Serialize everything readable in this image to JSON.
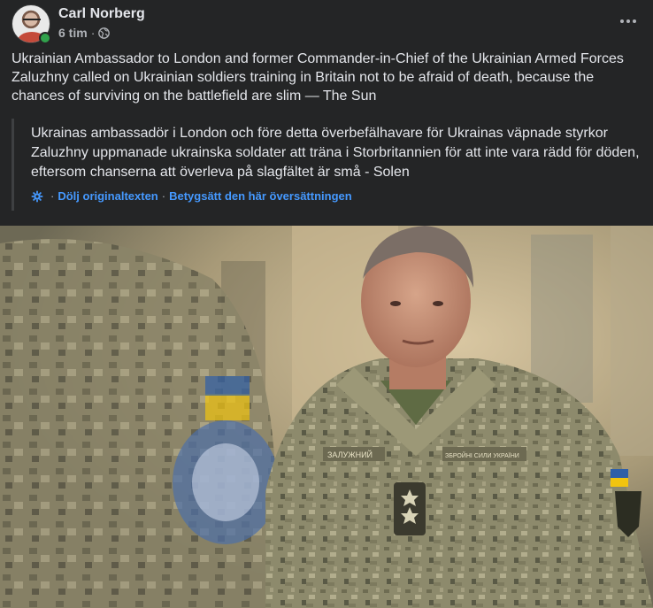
{
  "post": {
    "author": "Carl Norberg",
    "time": "6 tim",
    "separator": "·",
    "audience_icon": "globe-icon",
    "more_icon": "more-options-icon",
    "text": "Ukrainian Ambassador to London and former Commander-in-Chief of the Ukrainian Armed Forces Zaluzhny called on Ukrainian soldiers training in Britain not to be afraid of death, because the chances of surviving on the battlefield are slim — The Sun"
  },
  "translation": {
    "text": "Ukrainas ambassadör i London och före detta överbefälhavare för Ukrainas väpnade styrkor Zaluzhny uppmanade ukrainska soldater att träna i Storbritannien för att inte vara rädd för döden, eftersom chanserna att överleva på slagfältet är små - Solen",
    "separator": "·",
    "hide_original": "Dölj originaltexten",
    "rate_translation": "Betygsätt den här översättningen",
    "settings_icon": "gear-icon"
  },
  "photo": {
    "patch_text": "ЗАЛУЖНИЙ",
    "patch_text_right": "ЗБРОЙНІ СИЛИ УКРАЇНИ"
  },
  "colors": {
    "background": "#242526",
    "text": "#e4e6eb",
    "secondary": "#b0b3b8",
    "link": "#4599ff",
    "online": "#31a24c"
  }
}
